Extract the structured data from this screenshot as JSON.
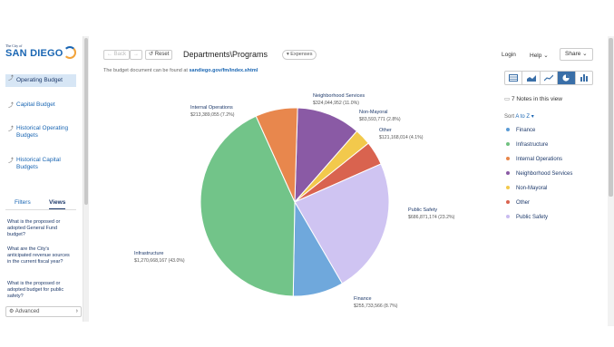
{
  "sidebar": {
    "logo_top": "The City of",
    "logo_main": "SAN DIEGO",
    "items": [
      {
        "label": "Operating Budget",
        "active": true
      },
      {
        "label": "Capital Budget",
        "active": false
      },
      {
        "label": "Historical Operating Budgets",
        "active": false
      },
      {
        "label": "Historical Capital Budgets",
        "active": false
      }
    ],
    "tabs": [
      "Filters",
      "Views"
    ],
    "active_tab": "Views",
    "questions": [
      "What is the proposed or adopted General Fund budget?",
      "What are the City's anticipated revenue sources in the current fiscal year?",
      "What is the proposed or adopted budget for public safety?"
    ],
    "advanced_label": "Advanced"
  },
  "toolbar": {
    "back_label": "Back",
    "reset_label": "Reset",
    "title": "Departments\\Programs",
    "filter_chip": "Expenses",
    "note_prefix": "The budget document can be found at",
    "note_link": "sandiego.gov/fm/index.shtml"
  },
  "header": {
    "login": "Login",
    "help": "Help",
    "share": "Share"
  },
  "notes_label": "7 Notes in this view",
  "sort_prefix": "Sort",
  "sort_value": "A to Z",
  "legend": [
    {
      "name": "Finance",
      "color": "#5b9bd5"
    },
    {
      "name": "Infrastructure",
      "color": "#70c17f"
    },
    {
      "name": "Internal Operations",
      "color": "#e8864a"
    },
    {
      "name": "Neighborhood Services",
      "color": "#8a5aa5"
    },
    {
      "name": "Non-Mayoral",
      "color": "#f2c94c"
    },
    {
      "name": "Other",
      "color": "#d9634f"
    },
    {
      "name": "Public Safety",
      "color": "#c9bcf0"
    }
  ],
  "chart_data": {
    "type": "pie",
    "series": [
      {
        "name": "Neighborhood Services",
        "value": 324044952,
        "label_value": "$324,044,952 (11.0%)",
        "color": "#8a5aa5",
        "share": 11.0
      },
      {
        "name": "Non-Mayoral",
        "value": 83593771,
        "label_value": "$83,593,771 (2.8%)",
        "color": "#f2c94c",
        "share": 2.8
      },
      {
        "name": "Other",
        "value": 121168014,
        "label_value": "$121,168,014 (4.1%)",
        "color": "#d9634f",
        "share": 4.1
      },
      {
        "name": "Public Safety",
        "value": 686871174,
        "label_value": "$686,871,174 (23.2%)",
        "color": "#cfc4f2",
        "share": 23.2
      },
      {
        "name": "Finance",
        "value": 255733566,
        "label_value": "$255,733,566 (8.7%)",
        "color": "#6fa8dc",
        "share": 8.7
      },
      {
        "name": "Infrastructure",
        "value": 1270668167,
        "label_value": "$1,270,668,167 (43.0%)",
        "color": "#72c489",
        "share": 43.0
      },
      {
        "name": "Internal Operations",
        "value": 213389055,
        "label_value": "$213,389,055 (7.2%)",
        "color": "#e8874d",
        "share": 7.2
      }
    ]
  }
}
